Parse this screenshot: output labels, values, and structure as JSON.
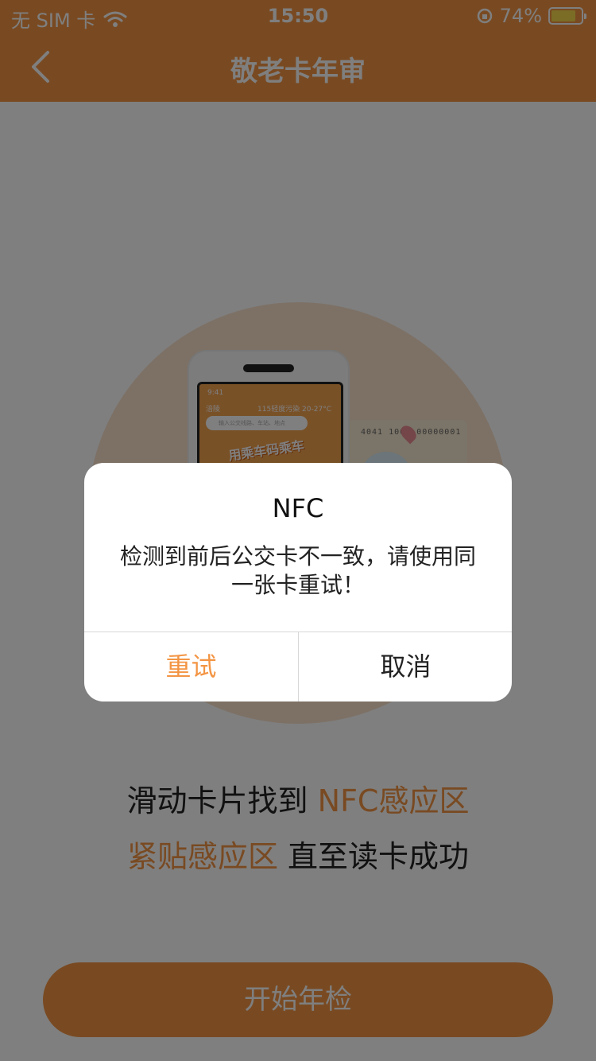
{
  "status_bar": {
    "carrier": "无 SIM 卡",
    "time": "15:50",
    "battery_percent": "74%",
    "battery_level": 0.74
  },
  "nav": {
    "title": "敬老卡年审"
  },
  "illustration": {
    "phone_time": "9:41",
    "phone_city": "涪陵",
    "phone_weather": "115轻度污染 20-27°C",
    "phone_search_placeholder": "输入公交线路、车站、地点",
    "phone_banner": "用乘车码乘车",
    "card_number": "4041 1000 00000001"
  },
  "instruction": {
    "line1_plain": "滑动卡片找到",
    "line1_highlight": "NFC感应区",
    "line2_highlight": "紧贴感应区",
    "line2_plain": "直至读卡成功"
  },
  "start_button": "开始年检",
  "dialog": {
    "title": "NFC",
    "message": "检测到前后公交卡不一致，请使用同一张卡重试！",
    "retry_label": "重试",
    "cancel_label": "取消"
  },
  "colors": {
    "accent": "#F39544",
    "overlay": "rgba(0,0,0,0.5)"
  }
}
